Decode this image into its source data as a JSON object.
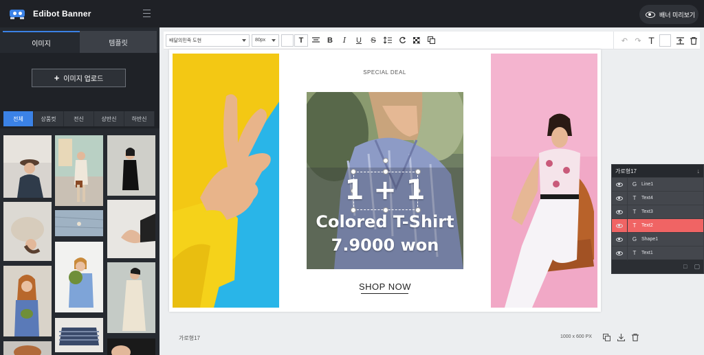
{
  "app": {
    "title": "Edibot Banner",
    "preview_label": "배너 미리보기"
  },
  "sidebar": {
    "tabs": [
      {
        "label": "이미지"
      },
      {
        "label": "템플릿"
      }
    ],
    "upload_label": "이미지 업로드",
    "filters": [
      {
        "label": "전체"
      },
      {
        "label": "상품컷"
      },
      {
        "label": "전신"
      },
      {
        "label": "상반신"
      },
      {
        "label": "하반신"
      }
    ]
  },
  "toolbar": {
    "font_family": "배달의민족 도현",
    "font_size": "80px",
    "icons": [
      "text-icon",
      "align-icon",
      "bold-icon",
      "italic-icon",
      "underline-icon",
      "strikethrough-icon",
      "line-height-icon",
      "rotate-icon",
      "transparency-icon",
      "duplicate-icon"
    ],
    "right_icons": [
      "undo-icon",
      "redo-icon",
      "text-icon",
      "color-swatch",
      "arrange-icon",
      "delete-icon"
    ]
  },
  "canvas": {
    "special_deal": "SPECIAL DEAL",
    "headline": "1 + 1",
    "subline": "Colored T-Shirt",
    "price": "7.9000 won",
    "cta": "SHOP NOW"
  },
  "layers": {
    "title": "가로형17",
    "items": [
      {
        "type": "G",
        "label": "Line1",
        "active": false
      },
      {
        "type": "T",
        "label": "Text4",
        "active": false
      },
      {
        "type": "T",
        "label": "Text3",
        "active": false
      },
      {
        "type": "T",
        "label": "Text2",
        "active": true
      },
      {
        "type": "G",
        "label": "Shape1",
        "active": false
      },
      {
        "type": "T",
        "label": "Text1",
        "active": false
      }
    ]
  },
  "status": {
    "banner_name": "가로형17",
    "canvas_size": "1000 x 600 PX"
  },
  "colors": {
    "accent": "#3b82e6",
    "layer_active": "#f06464",
    "topbar": "#1f2126",
    "sidebar": "#262a30"
  }
}
